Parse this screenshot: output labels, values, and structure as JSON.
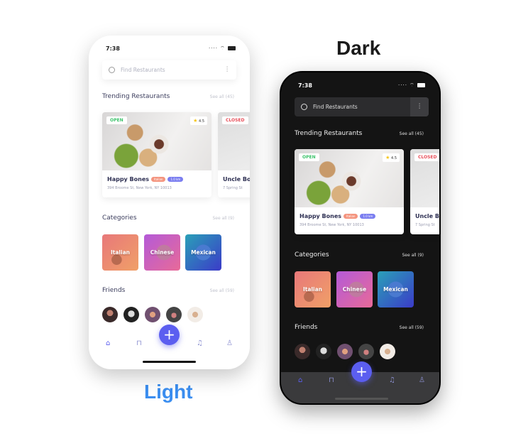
{
  "labels": {
    "dark": "Dark",
    "light": "Light"
  },
  "app": {
    "time": "7:38",
    "search_placeholder": "Find Restaurants",
    "trending": {
      "title": "Trending Restaurants",
      "see_all": "See all (45)"
    },
    "restaurants": [
      {
        "status": "OPEN",
        "status_color": "#3cc36b",
        "rating": "4.5",
        "name": "Happy Bones",
        "tags": [
          "Italian",
          "1.0 km"
        ],
        "address": "394 Broome St, New York, NY 10013"
      },
      {
        "status": "CLOSED",
        "status_color": "#e8505b",
        "name": "Uncle Boons",
        "address": "7 Spring St"
      }
    ],
    "categories": {
      "title": "Categories",
      "see_all": "See all (9)",
      "items": [
        "Italian",
        "Chinese",
        "Mexican"
      ]
    },
    "friends": {
      "title": "Friends",
      "see_all": "See all (59)"
    },
    "fab": "+",
    "nav": [
      "home-icon",
      "bookmark-icon",
      "bell-icon",
      "user-icon"
    ],
    "accent": "#5b5ef0"
  }
}
